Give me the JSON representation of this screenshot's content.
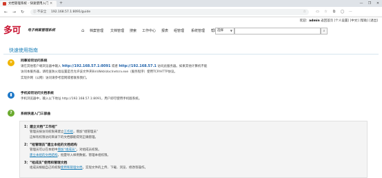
{
  "browser": {
    "tab_title": "文档管理系统 - 快速使用入门",
    "tab_close": "×",
    "new_tab": "+",
    "win_minimize": "—",
    "win_restore": "❐",
    "win_close": "✕",
    "back": "←",
    "forward": "→",
    "reload": "↻",
    "security_label": "ⓘ 不安全",
    "url": "192.168.57.1:8091/guide",
    "star": "☆"
  },
  "header": {
    "logo": "多可",
    "logo_sub": "电子档案管理系统",
    "user_prefix": "欢迎：",
    "user_name": "admin",
    "user_suffix": " 返回首页 [个人设置] [中文] [帮助] [退出]",
    "nav": [
      "档案管理",
      "文档管理",
      "搜索",
      "工作中心",
      "报表",
      "组管理",
      "系统管理",
      "帮助"
    ],
    "select_value": "选择",
    "search_btn": "⌕"
  },
  "guide": {
    "title": "快速使用指南",
    "sections": [
      {
        "head": "同事如何访问系统",
        "lines": [
          {
            "pre": "请在其他客户端浏览器中输入 ",
            "ip1": "http://192.168.57.1:8091",
            "mid": " 或者 ",
            "ip2": "http://192.168.57.1",
            "post": " 访问此服务器。如果其他计算机不能"
          },
          {
            "text": "访问本服务器，请检查防火墙设置是否允许该文件夹Bin\\Web\\doclnetsrv.exe（服务程序）使用TCP/HTTP协议。"
          },
          {
            "text": "实现外网（公网）访问请参考官网或者联系我们。"
          }
        ]
      },
      {
        "head": "手机如何访问文档系统",
        "lines": [
          {
            "text": "手机浏览器中，输入以下地址 http://192.168.57.1:8091，用户即可使用手机版系统。"
          }
        ]
      },
      {
        "head": "系统快速入门三部曲"
      }
    ],
    "steps": [
      {
        "title": "1：建立文档“工作组”",
        "lines": [
          {
            "pre": "管理员按访问权限来建立",
            "link": "工作组",
            "post": "，增加“组管理员”"
          },
          {
            "text": "这样有权限访问目录下的文档都能得到正确管理。"
          }
        ]
      },
      {
        "title": "2：“组管理员”建立本组的文档结构",
        "lines": [
          {
            "pre": "管理员可以在本组中",
            "link": "增加“组成员”",
            "post": "，对组成员权限。"
          },
          {
            "link": "建立本组的文档结构",
            "post": "，批量导入样例数据，管理本组权限。"
          }
        ]
      },
      {
        "title": "3：“组成员”使用和管理文档",
        "lines": [
          {
            "pre": "组成员根据自己的权限",
            "link": "使用和管理文档",
            "post": "，实现文件的上传、下载、浏览、修改等操作。"
          }
        ]
      }
    ]
  },
  "colors": {
    "accent": "#1b7fb8",
    "brand": "#c8102e"
  }
}
